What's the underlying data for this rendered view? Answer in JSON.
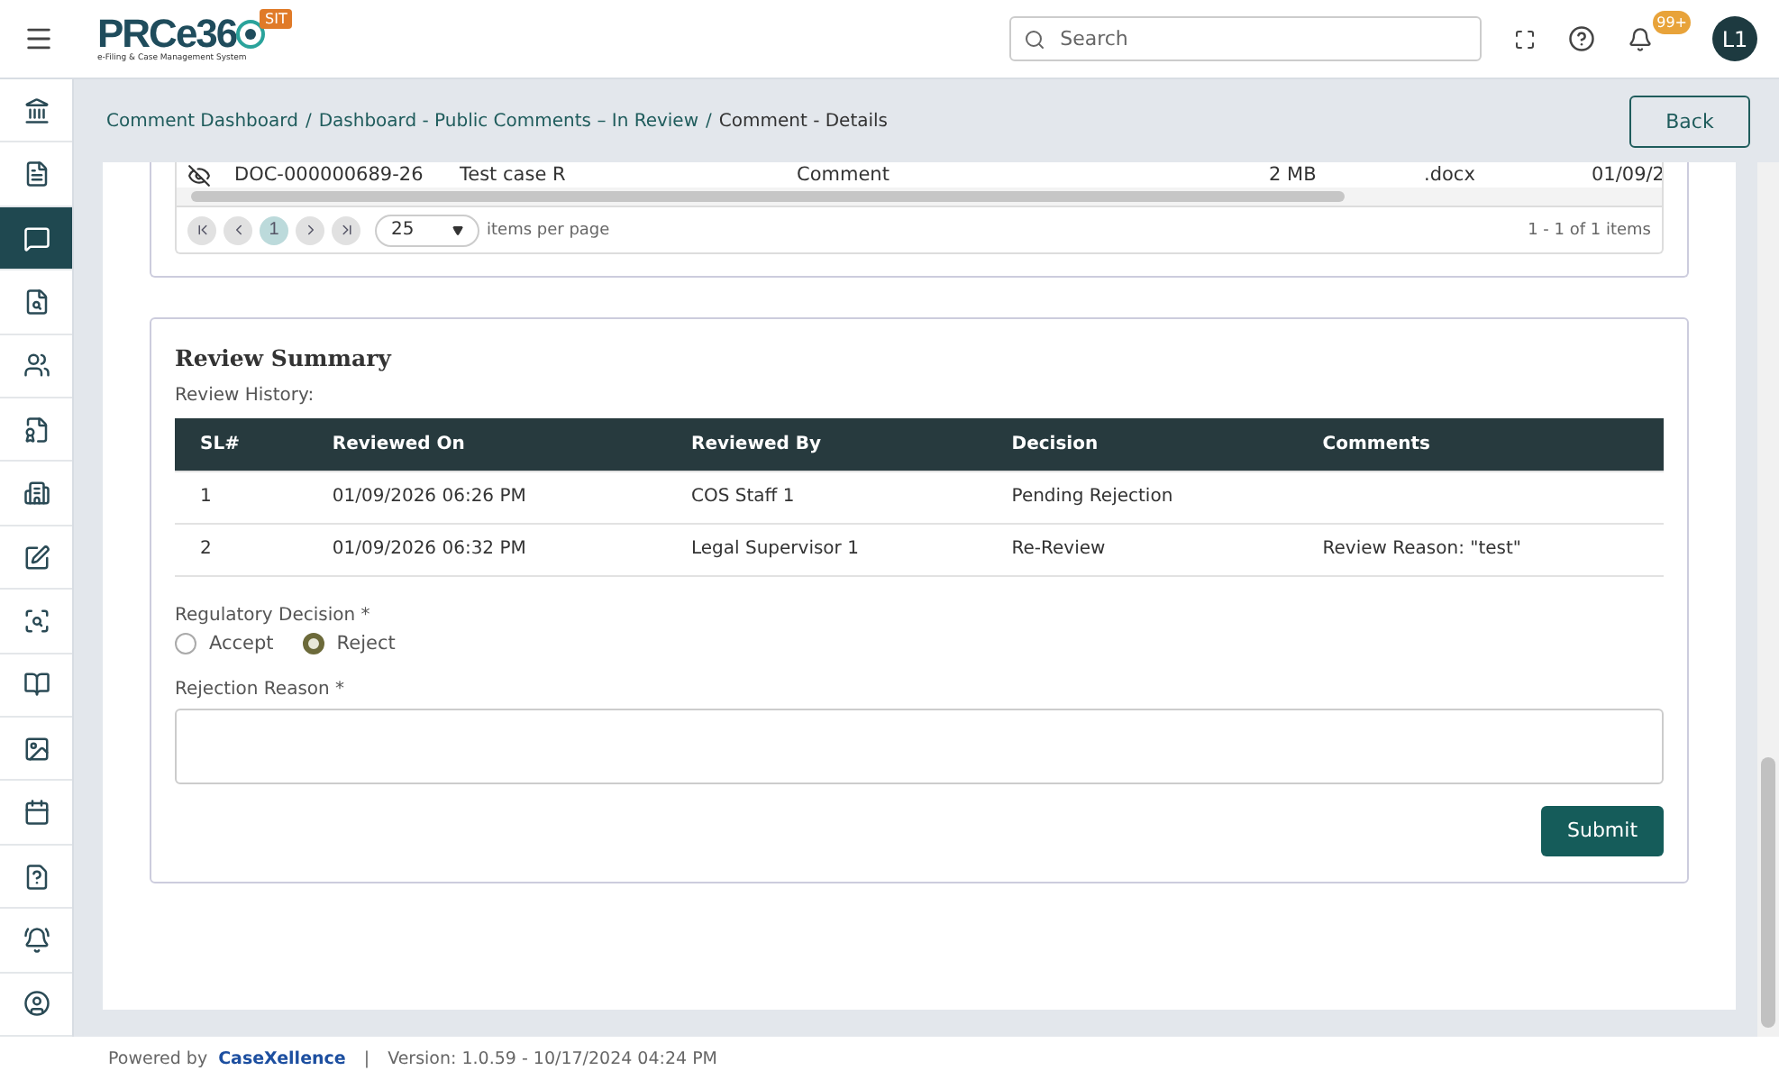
{
  "header": {
    "logo": "PRCe36",
    "logo_subtitle": "e-Filing & Case Management System",
    "env_badge": "SIT",
    "search": {
      "placeholder": "Search"
    },
    "notification_count": "99+",
    "avatar": "L1"
  },
  "sidebar": {
    "items": [
      {
        "selected": false
      },
      {
        "selected": false
      },
      {
        "selected": true
      },
      {
        "selected": false
      },
      {
        "selected": false
      },
      {
        "selected": false
      },
      {
        "selected": false
      },
      {
        "selected": false
      },
      {
        "selected": false
      },
      {
        "selected": false
      },
      {
        "selected": false
      },
      {
        "selected": false
      },
      {
        "selected": false
      },
      {
        "selected": false
      },
      {
        "selected": false
      }
    ]
  },
  "breadcrumb": {
    "links": [
      "Comment Dashboard",
      "Dashboard - Public Comments – In Review"
    ],
    "separator": "/",
    "current": "Comment - Details"
  },
  "back_button": "Back",
  "documents": {
    "rows": [
      {
        "id": "DOC-000000689-26",
        "name": "Test case R",
        "type": "Comment",
        "size": "2 MB",
        "ext": ".docx",
        "date": "01/09/2"
      }
    ],
    "pager": {
      "current_page": "1",
      "page_size": "25",
      "page_size_label": "items per page",
      "summary": "1 - 1 of 1 items"
    }
  },
  "review_summary": {
    "title": "Review Summary",
    "history_label": "Review History:",
    "columns": [
      "SL#",
      "Reviewed On",
      "Reviewed By",
      "Decision",
      "Comments"
    ],
    "rows": [
      [
        "1",
        "01/09/2026 06:26 PM",
        "COS Staff 1",
        "Pending Rejection",
        ""
      ],
      [
        "2",
        "01/09/2026 06:32 PM",
        "Legal Supervisor 1",
        "Re-Review",
        "Review Reason: \"test\""
      ]
    ]
  },
  "decision": {
    "label": "Regulatory Decision *",
    "options": [
      {
        "label": "Accept",
        "selected": false
      },
      {
        "label": "Reject",
        "selected": true
      }
    ]
  },
  "rejection_reason": {
    "label": "Rejection Reason *"
  },
  "submit_button": "Submit",
  "footer": {
    "powered_by": "Powered by",
    "brand": "CaseXellence",
    "separator": "|",
    "version": "Version: 1.0.59 - 10/17/2024 04:24 PM"
  }
}
